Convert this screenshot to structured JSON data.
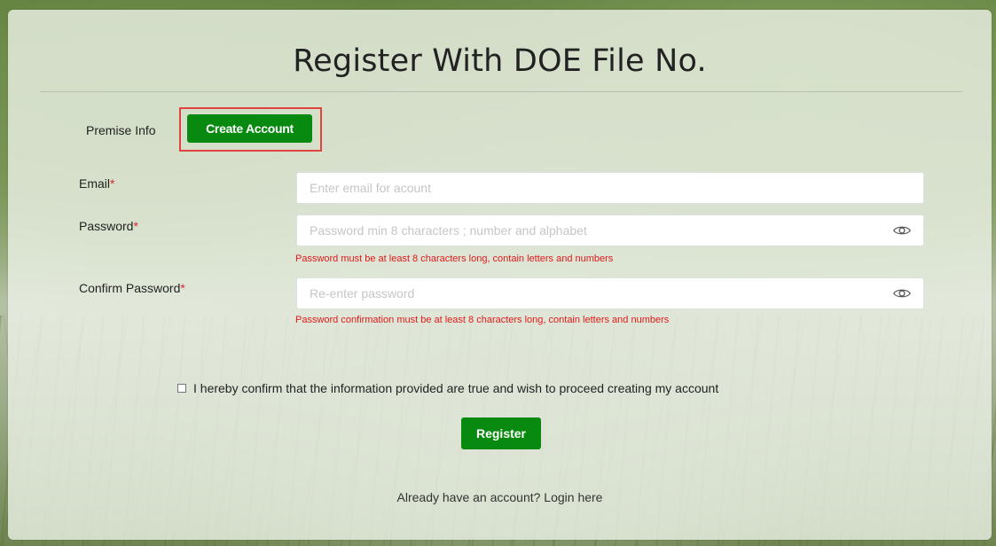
{
  "page": {
    "title": "Register With DOE File No."
  },
  "tabs": {
    "premise_info": "Premise Info",
    "create_account": "Create Account"
  },
  "form": {
    "email": {
      "label": "Email",
      "required_mark": "*",
      "placeholder": "Enter email for acount",
      "value": ""
    },
    "password": {
      "label": "Password",
      "required_mark": "*",
      "placeholder": "Password min 8 characters ; number and alphabet",
      "value": "",
      "error": "Password must be at least 8 characters long, contain letters and numbers",
      "toggle_icon": "eye-icon"
    },
    "confirm_password": {
      "label": "Confirm Password",
      "required_mark": "*",
      "placeholder": "Re-enter password",
      "value": "",
      "error": "Password confirmation must be at least 8 characters long, contain letters and numbers",
      "toggle_icon": "eye-icon"
    },
    "agreement": {
      "label": "I hereby confirm that the information provided are true and wish to proceed creating my account",
      "checked": false
    },
    "register_button": "Register",
    "login_link": "Already have an account? Login here"
  },
  "colors": {
    "accent_green": "#078a0f",
    "error_red": "#e01a1a",
    "highlight_border": "#e0443f"
  }
}
